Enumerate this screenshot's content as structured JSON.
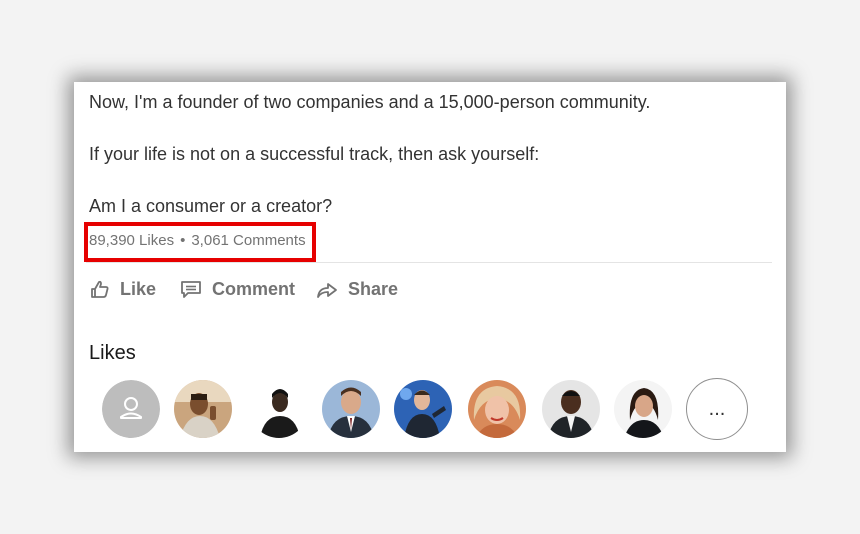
{
  "post": {
    "lines": [
      "Now, I'm a founder of two companies and a 15,000-person community.",
      "If your life is not on a successful track, then ask yourself:",
      "Am I a consumer or a creator?"
    ],
    "likes_count": "89,390 Likes",
    "separator": "•",
    "comments_count": "3,061 Comments"
  },
  "actions": {
    "like_label": "Like",
    "comment_label": "Comment",
    "share_label": "Share"
  },
  "likes_section": {
    "heading": "Likes",
    "avatars": [
      {
        "kind": "placeholder",
        "icon": "person-icon"
      },
      {
        "kind": "photo"
      },
      {
        "kind": "photo"
      },
      {
        "kind": "photo"
      },
      {
        "kind": "photo"
      },
      {
        "kind": "photo"
      },
      {
        "kind": "photo"
      },
      {
        "kind": "photo"
      }
    ],
    "more_label": "..."
  },
  "colors": {
    "highlight_border": "#e60000",
    "meta_text": "#737373",
    "body_text": "#333333"
  }
}
